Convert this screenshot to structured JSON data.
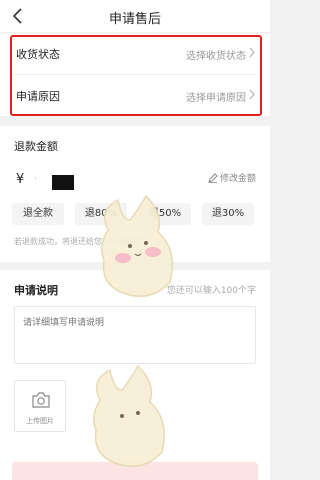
{
  "nav": {
    "title": "申请售后"
  },
  "status": {
    "receipt_label": "收货状态",
    "receipt_value": "选择收货状态",
    "reason_label": "申请原因",
    "reason_value": "选择申请原因"
  },
  "refund": {
    "heading": "退款金额",
    "currency": "¥",
    "edit_label": "修改金额",
    "chips": [
      "退全款",
      "退80%",
      "退50%",
      "退30%"
    ],
    "tip": "若退款成功，将退还给您¥4.90现金"
  },
  "description": {
    "heading": "申请说明",
    "counter": "您还可以输入100个字",
    "placeholder": "请详细填写申请说明",
    "upload_label": "上传图片"
  },
  "colors": {
    "highlight": "#e02020",
    "primary_light": "#fce4e4"
  }
}
